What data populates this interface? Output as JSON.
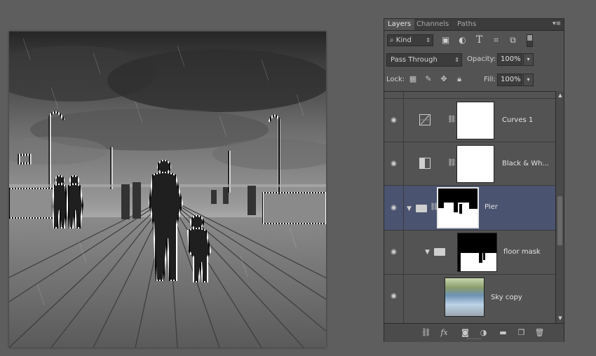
{
  "panel": {
    "tabs": [
      "Layers",
      "Channels",
      "Paths"
    ],
    "active_tab": "Layers",
    "kind_label": "Kind",
    "filter_icons": [
      "image-filter-icon",
      "adjustment-filter-icon",
      "type-filter-icon",
      "shape-filter-icon",
      "smart-object-filter-icon"
    ],
    "blend_mode": "Pass Through",
    "opacity_label": "Opacity:",
    "opacity_value": "100%",
    "lock_label": "Lock:",
    "fill_label": "Fill:",
    "fill_value": "100%",
    "layers": [
      {
        "name": "Curves 1",
        "type": "adjustment"
      },
      {
        "name": "Black & Wh...",
        "type": "adjustment"
      },
      {
        "name": "Pier",
        "type": "group",
        "selected": true
      },
      {
        "name": "floor mask",
        "type": "group"
      },
      {
        "name": "Sky copy",
        "type": "image"
      }
    ],
    "bottom_icons": [
      "link-layers-icon",
      "fx-icon",
      "add-mask-icon",
      "new-adjustment-icon",
      "new-group-icon",
      "new-layer-icon",
      "delete-layer-icon"
    ],
    "fx_label": "fx"
  },
  "colors": {
    "workspace": "#5e5e5e",
    "panel": "#535353",
    "selected_layer": "#4a5470"
  }
}
